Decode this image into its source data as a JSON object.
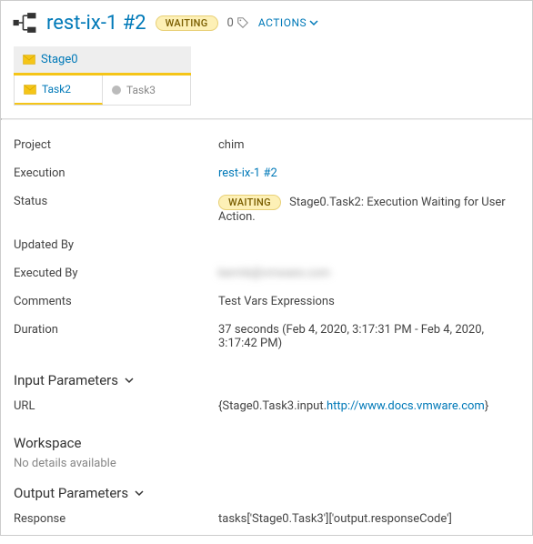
{
  "header": {
    "title": "rest-ix-1 #2",
    "status_badge": "WAITING",
    "tag_count": "0",
    "actions_label": "ACTIONS"
  },
  "stage": {
    "name": "Stage0",
    "tasks": [
      {
        "name": "Task2",
        "state": "waiting"
      },
      {
        "name": "Task3",
        "state": "pending"
      }
    ]
  },
  "details": {
    "project_label": "Project",
    "project_value": "chim",
    "execution_label": "Execution",
    "execution_value": "rest-ix-1 #2",
    "status_label": "Status",
    "status_badge": "WAITING",
    "status_message": "Stage0.Task2: Execution Waiting for User Action.",
    "updated_by_label": "Updated By",
    "updated_by_value": "",
    "executed_by_label": "Executed By",
    "executed_by_value": "kermb@vmware.com",
    "comments_label": "Comments",
    "comments_value": "Test Vars Expressions",
    "duration_label": "Duration",
    "duration_value": "37 seconds (Feb 4, 2020, 3:17:31 PM - Feb 4, 2020, 3:17:42 PM)"
  },
  "input_params": {
    "heading": "Input Parameters",
    "url_label": "URL",
    "url_prefix": "{Stage0.Task3.input.",
    "url_link": "http://www.docs.vmware.com",
    "url_suffix": "}"
  },
  "workspace": {
    "heading": "Workspace",
    "message": "No details available"
  },
  "output_params": {
    "heading": "Output Parameters",
    "response_label": "Response",
    "response_value": "tasks['Stage0.Task3']['output.responseCode']"
  }
}
